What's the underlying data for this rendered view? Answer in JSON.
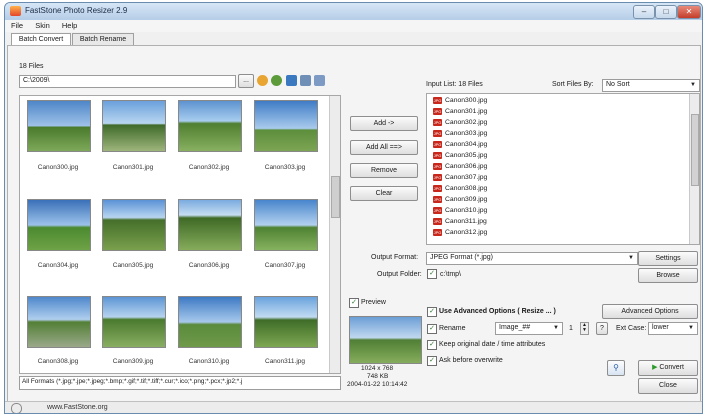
{
  "window": {
    "title": "FastStone Photo Resizer 2.9"
  },
  "menu": [
    "File",
    "Skin",
    "Help"
  ],
  "tabs": [
    {
      "label": "Batch Convert"
    },
    {
      "label": "Batch Rename"
    }
  ],
  "left": {
    "files_count": "18 Files",
    "folder_path": "C:\\2009\\",
    "browse_label": "...",
    "thumbnails": [
      {
        "name": "Canon300.jpg"
      },
      {
        "name": "Canon301.jpg"
      },
      {
        "name": "Canon302.jpg"
      },
      {
        "name": "Canon303.jpg"
      },
      {
        "name": "Canon304.jpg"
      },
      {
        "name": "Canon305.jpg"
      },
      {
        "name": "Canon306.jpg"
      },
      {
        "name": "Canon307.jpg"
      },
      {
        "name": "Canon308.jpg"
      },
      {
        "name": "Canon309.jpg"
      },
      {
        "name": "Canon310.jpg"
      },
      {
        "name": "Canon311.jpg"
      }
    ],
    "format_filter": "All Formats (*.jpg;*.jpe;*.jpeg;*.bmp;*.gif;*.tif;*.tiff;*.cur;*.ico;*.png;*.pcx;*.jp2;*.j"
  },
  "actions": {
    "add": "Add ->",
    "add_all": "Add All ==>",
    "remove": "Remove",
    "clear": "Clear"
  },
  "input_list": {
    "header": "Input List: 18 Files",
    "sort_label": "Sort Files By:",
    "sort_value": "No Sort",
    "items": [
      "Canon300.jpg",
      "Canon301.jpg",
      "Canon302.jpg",
      "Canon303.jpg",
      "Canon304.jpg",
      "Canon305.jpg",
      "Canon306.jpg",
      "Canon307.jpg",
      "Canon308.jpg",
      "Canon309.jpg",
      "Canon310.jpg",
      "Canon311.jpg",
      "Canon312.jpg"
    ]
  },
  "output": {
    "format_label": "Output Format:",
    "format_value": "JPEG Format (*.jpg)",
    "settings_label": "Settings",
    "folder_label": "Output Folder:",
    "folder_value": "c:\\tmp\\",
    "browse_label": "Browse"
  },
  "preview": {
    "label": "Preview",
    "dimensions": "1024 x 768",
    "size": "748 KB",
    "datetime": "2004-01-22 10:14:42"
  },
  "options": {
    "advanced_label": "Use Advanced Options ( Resize ... )",
    "advanced_button": "Advanced Options",
    "rename_label": "Rename",
    "rename_pattern": "Image_##",
    "start_number": "1",
    "help_label": "?",
    "ext_case_label": "Ext Case:",
    "ext_case_value": "lower",
    "keep_date_label": "Keep original date / time attributes",
    "ask_overwrite_label": "Ask before overwrite"
  },
  "buttons": {
    "convert": "Convert",
    "close": "Close"
  },
  "status": {
    "url": "www.FastStone.org"
  },
  "colors": {
    "title_bar": "#c6dbf1",
    "jpg_icon": "#c8281c",
    "convert_green": "#2a9a2a"
  }
}
